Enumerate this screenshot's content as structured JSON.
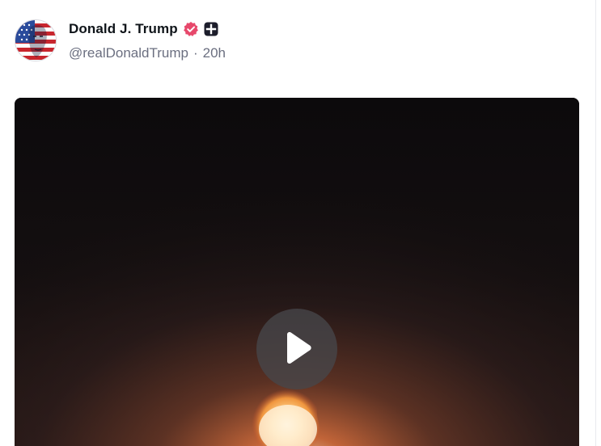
{
  "post": {
    "author": {
      "display_name": "Donald J. Trump",
      "handle": "@realDonaldTrump",
      "avatar_icon": "american-flag-portrait-avatar",
      "verified_icon": "verified-badge-icon",
      "verified_color": "#e7486b",
      "plus_badge_icon": "plus-badge-icon"
    },
    "separator": "·",
    "timestamp": "20h",
    "media": {
      "type": "video",
      "play_icon": "play-icon"
    }
  },
  "colors": {
    "name": "#0f1419",
    "meta": "#6b6f80",
    "video_bg": "#0d0b0c"
  }
}
